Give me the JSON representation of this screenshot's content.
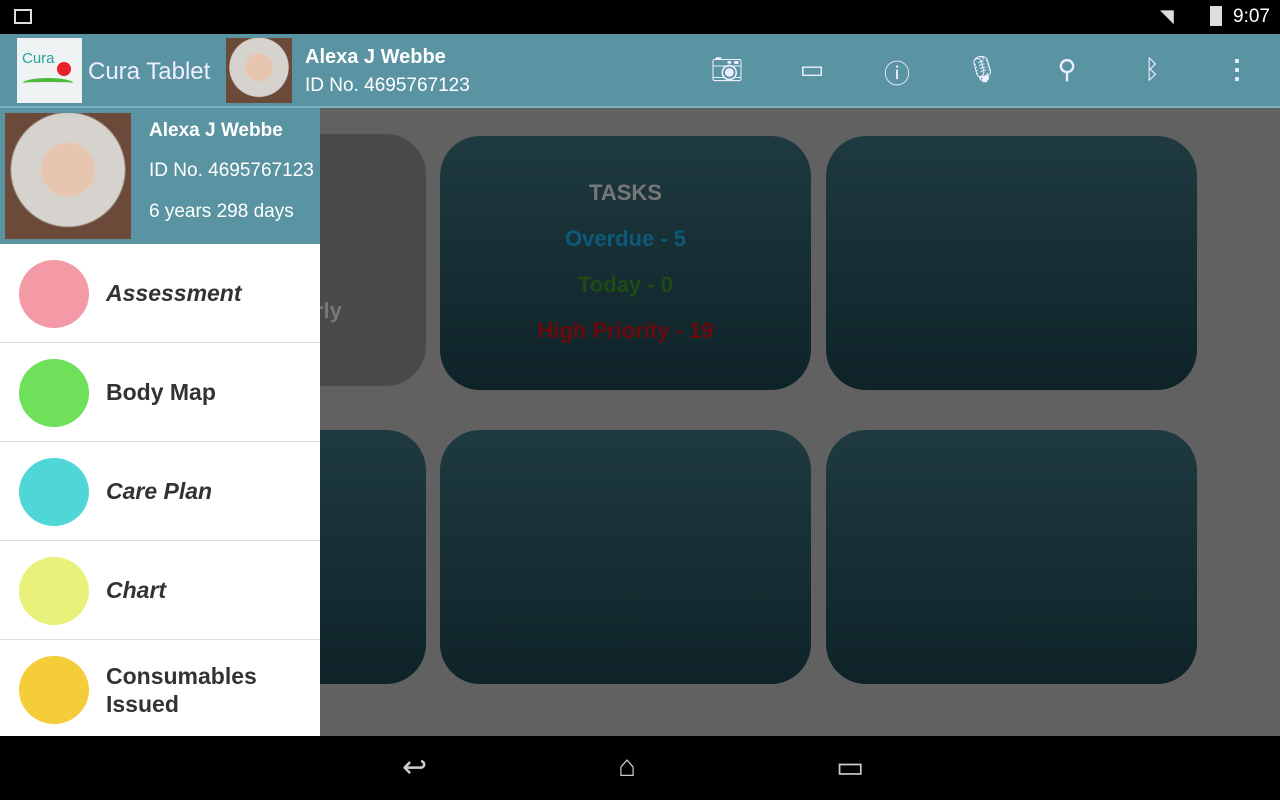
{
  "status": {
    "time": "9:07"
  },
  "appbar": {
    "title": "Cura Tablet",
    "logo_text": "Cura",
    "patient_name": "Alexa J Webbe",
    "patient_id": "ID No. 4695767123",
    "icons": [
      "camera-icon",
      "message-icon",
      "info-icon",
      "microphone-icon",
      "search-icon",
      "bluetooth-icon",
      "overflow-menu-icon"
    ]
  },
  "drawer": {
    "name": "Alexa J Webbe",
    "id": "ID No. 4695767123",
    "age": "6 years 298 days",
    "items": [
      {
        "label": "Assessment",
        "color": "#f49aa7"
      },
      {
        "label": "Body Map",
        "color": "#6ee05a"
      },
      {
        "label": "Care Plan",
        "color": "#4fd6d6"
      },
      {
        "label": "Chart",
        "color": "#e8f27a"
      },
      {
        "label": "Consumables Issued",
        "color": "#f5cc3a"
      }
    ]
  },
  "dashboard": {
    "partial_text": "rly",
    "tasks": {
      "title": "TASKS",
      "overdue": "Overdue - 5",
      "today": "Today - 0",
      "high": "High Priority - 19"
    },
    "colors": {
      "overdue": "#0d5a78",
      "today": "#1f4a12",
      "high": "#6b0a0c"
    }
  }
}
